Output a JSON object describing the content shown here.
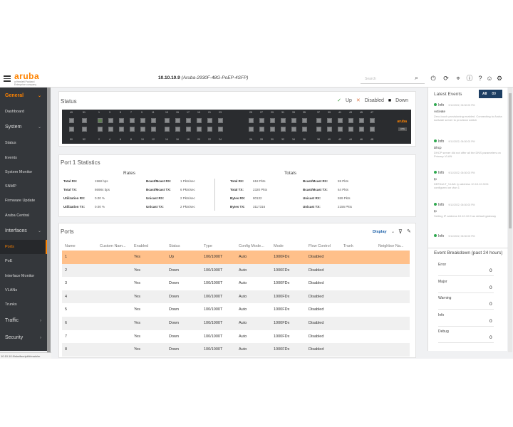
{
  "header": {
    "logo": "aruba",
    "logo_sub": "a Hewlett Packard Enterprise company",
    "device_ip": "10.10.10.9",
    "device_model": "(Aruba-2930F-48G-PoEP-4SFP)",
    "search_placeholder": "Search"
  },
  "sidebar": {
    "general": "General",
    "dashboard": "Dashboard",
    "system": "System",
    "system_items": [
      "Status",
      "Events",
      "System Monitor",
      "SNMP",
      "Firmware Update",
      "Aruba Central"
    ],
    "interfaces": "Interfaces",
    "interfaces_items": [
      "Ports",
      "PoE",
      "Interface Monitor",
      "VLANs",
      "Trunks"
    ],
    "traffic": "Traffic",
    "security": "Security",
    "url": "10.10.10.9/shellscript/#/main/m"
  },
  "status": {
    "title": "Status",
    "legend_up": "Up",
    "legend_disabled": "Disabled",
    "legend_down": "Down",
    "top_numbers": [
      "49",
      "51",
      "1",
      "3",
      "5",
      "7",
      "9",
      "11",
      "13",
      "15",
      "17",
      "19",
      "21",
      "23",
      "25",
      "27",
      "29",
      "31",
      "33",
      "35",
      "37",
      "39",
      "41",
      "43",
      "45",
      "47"
    ],
    "bottom_numbers": [
      "50",
      "52",
      "2",
      "4",
      "6",
      "8",
      "10",
      "12",
      "14",
      "16",
      "18",
      "20",
      "22",
      "24",
      "26",
      "28",
      "30",
      "32",
      "34",
      "36",
      "38",
      "40",
      "42",
      "44",
      "46",
      "48"
    ],
    "brand": "aruba",
    "brand_box": "HPE"
  },
  "port1": {
    "title": "Port 1 Statistics",
    "rates_header": "Rates",
    "totals_header": "Totals",
    "rates": [
      {
        "k": "Total RX:",
        "v": "1968 bps",
        "k2": "Bcast/Mcast RX:",
        "v2": "1 Pkts/sec"
      },
      {
        "k": "Total TX:",
        "v": "86984 bps",
        "k2": "Bcast/Mcast TX:",
        "v2": "6 Pkts/sec"
      },
      {
        "k": "Utilization RX:",
        "v": "0.00 %",
        "k2": "Unicast RX:",
        "v2": "2 Pkts/sec"
      },
      {
        "k": "Utilization TX:",
        "v": "0.00 %",
        "k2": "Unicast TX:",
        "v2": "2 Pkts/sec"
      }
    ],
    "totals": [
      {
        "k": "Total RX:",
        "v": "618 Pkts",
        "k2": "Bcast/Mcast RX:",
        "v2": "59 Pkts"
      },
      {
        "k": "Total TX:",
        "v": "2320 Pkts",
        "k2": "Bcast/Mcast TX:",
        "v2": "64 Pkts"
      },
      {
        "k": "Bytes RX:",
        "v": "80132",
        "k2": "Unicast RX:",
        "v2": "559 Pkts"
      },
      {
        "k": "Bytes TX:",
        "v": "3117316",
        "k2": "Unicast TX:",
        "v2": "2156 Pkts"
      }
    ]
  },
  "ports": {
    "title": "Ports",
    "display": "Display",
    "columns": [
      "Name",
      "Custom Nam...",
      "Enabled",
      "Status",
      "Type",
      "Config Mode...",
      "Mode",
      "Flow Control",
      "Trunk",
      "Neighbor Na..."
    ],
    "rows": [
      [
        "1",
        "",
        "Yes",
        "Up",
        "100/1000T",
        "Auto",
        "1000FDx",
        "Disabled",
        "",
        ""
      ],
      [
        "2",
        "",
        "Yes",
        "Down",
        "100/1000T",
        "Auto",
        "1000FDx",
        "Disabled",
        "",
        ""
      ],
      [
        "3",
        "",
        "Yes",
        "Down",
        "100/1000T",
        "Auto",
        "1000FDx",
        "Disabled",
        "",
        ""
      ],
      [
        "4",
        "",
        "Yes",
        "Down",
        "100/1000T",
        "Auto",
        "1000FDx",
        "Disabled",
        "",
        ""
      ],
      [
        "5",
        "",
        "Yes",
        "Down",
        "100/1000T",
        "Auto",
        "1000FDx",
        "Disabled",
        "",
        ""
      ],
      [
        "6",
        "",
        "Yes",
        "Down",
        "100/1000T",
        "Auto",
        "1000FDx",
        "Disabled",
        "",
        ""
      ],
      [
        "7",
        "",
        "Yes",
        "Down",
        "100/1000T",
        "Auto",
        "1000FDx",
        "Disabled",
        "",
        ""
      ],
      [
        "8",
        "",
        "Yes",
        "Down",
        "100/1000T",
        "Auto",
        "1000FDx",
        "Disabled",
        "",
        ""
      ]
    ]
  },
  "events": {
    "title": "Latest Events",
    "all_label": "All",
    "all_count": "89",
    "items": [
      {
        "level": "Info",
        "time": "9/11/2022, 06:30:03 PM",
        "title": "Activate",
        "desc": "Zero-touch provisioning enabled. Connecting to Aruba Activate server to provision switch"
      },
      {
        "level": "Info",
        "time": "9/11/2022, 06:30:03 PM",
        "title": "Dhcp",
        "desc": "DHCP server did not offer all the DNS parameters on Primary VLAN"
      },
      {
        "level": "Info",
        "time": "9/11/2022, 06:30:03 PM",
        "title": "Ip",
        "desc": "DEFAULT_VLAN: ip address 10.10.10.9/24 configured on vlan 1"
      },
      {
        "level": "Info",
        "time": "9/11/2022, 06:30:03 PM",
        "title": "Ip",
        "desc": "Setting IP address 10.10.10.9 as default gateway"
      },
      {
        "level": "Info",
        "time": "9/11/2022, 06:30:03 PM",
        "title": "",
        "desc": ""
      }
    ],
    "breakdown_title": "Event Breakdown (past 24 hours)",
    "breakdown": [
      {
        "label": "Error",
        "value": "0"
      },
      {
        "label": "Major",
        "value": "0"
      },
      {
        "label": "Warning",
        "value": "0"
      },
      {
        "label": "Info",
        "value": "0"
      },
      {
        "label": "Debug",
        "value": "0"
      }
    ]
  },
  "colors": {
    "accent": "#ff8300",
    "sidebar": "#34373b",
    "selected_row": "#ffc08a",
    "nav_dark": "#1d3e63"
  }
}
